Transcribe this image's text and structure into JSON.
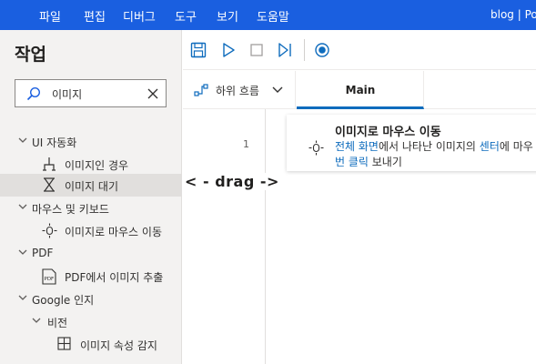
{
  "menubar": {
    "items": [
      "파일",
      "편집",
      "디버그",
      "도구",
      "보기",
      "도움말"
    ],
    "title": "blog | Pov"
  },
  "actions_panel": {
    "title": "작업",
    "search": {
      "value": "이미지"
    },
    "tree": [
      {
        "label": "UI 자동화",
        "kind": "group"
      },
      {
        "label": "이미지인 경우",
        "kind": "item"
      },
      {
        "label": "이미지 대기",
        "kind": "item"
      },
      {
        "label": "마우스 및 키보드",
        "kind": "group"
      },
      {
        "label": "이미지로 마우스 이동",
        "kind": "item"
      },
      {
        "label": "PDF",
        "kind": "group"
      },
      {
        "label": "PDF에서 이미지 추출",
        "kind": "item"
      },
      {
        "label": "Google 인지",
        "kind": "group"
      },
      {
        "label": "비전",
        "kind": "subgroup"
      },
      {
        "label": "이미지 속성 감지",
        "kind": "item"
      }
    ]
  },
  "tabs": {
    "subflows_label": "하위 흐름",
    "main_label": "Main"
  },
  "flow": {
    "line_number": "1",
    "action": {
      "title": "이미지로 마우스 이동",
      "desc_1": "전체 화면",
      "desc_2": "에서 나타난 이미지의 ",
      "desc_3": "센터",
      "desc_4": "에 마우",
      "desc_5": "번 클릭",
      "desc_6": " 보내기"
    }
  },
  "overlay": {
    "drag_hint": "< - drag ->"
  },
  "colors": {
    "menubar_bg": "#1a5fe0",
    "accent": "#0f6cbd",
    "panel_bg": "#f3f2f1"
  }
}
